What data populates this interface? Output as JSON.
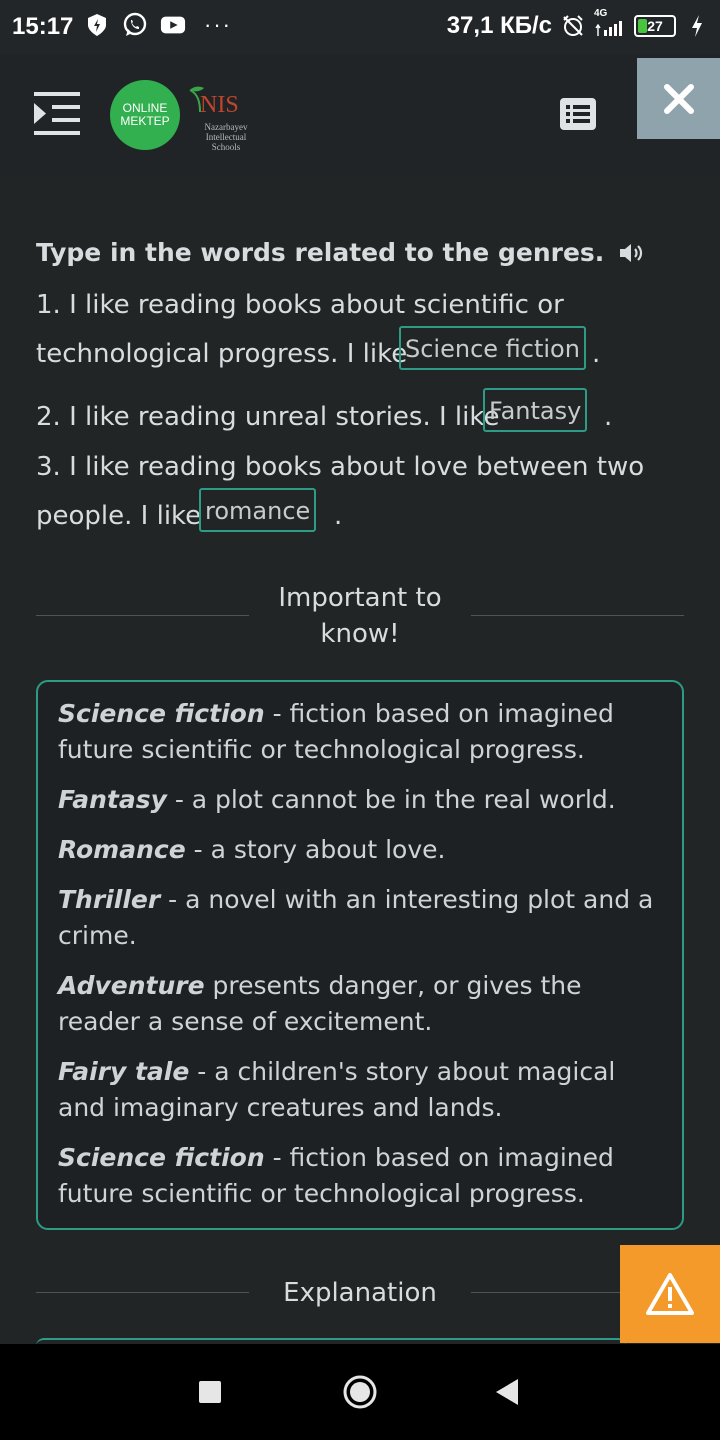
{
  "status_bar": {
    "time": "15:17",
    "network_speed": "37,1 КБ/с",
    "network_type": "4G",
    "battery": "27",
    "more_dots": "···"
  },
  "header": {
    "logo_line1": "ONLINE",
    "logo_line2": "MEKTEP",
    "nis_title": "NIS",
    "nis_subtitle": "Nazarbayev Intellectual Schools"
  },
  "task": {
    "title": "Type in the words related to the genres.",
    "q1_line1": "1. I like reading books about scientific or",
    "q1_line2": "technological progress. I like",
    "q1_answer": "Science fiction",
    "q2_text": "2. I like reading unreal stories. I like",
    "q2_answer": "Fantasy",
    "q3_line1": "3. I like reading books about love between two",
    "q3_line2": "people. I like",
    "q3_answer": "romance",
    "period": "."
  },
  "important": {
    "label": "Important to know!",
    "items": [
      {
        "term": "Science fiction",
        "text": " - fiction based on imagined future scientific or technological progress."
      },
      {
        "term": "Fantasy",
        "text": " - a plot cannot be in the real world."
      },
      {
        "term": "Romance",
        "text": " - a story about love."
      },
      {
        "term": "Thriller",
        "text": " - a novel with an interesting plot and a crime."
      },
      {
        "term": "Adventure",
        "text": " presents danger, or gives the reader a sense of excitement."
      },
      {
        "term": "Fairy tale",
        "text": " - a children's story about magical and imaginary creatures and lands."
      },
      {
        "term": "Science fiction",
        "text": " - fiction based on imagined future scientific or technological progress."
      }
    ]
  },
  "explanation": {
    "label": "Explanation"
  },
  "colors": {
    "accent_teal": "#2d9b86",
    "logo_green": "#32b050",
    "warning_orange": "#f39a2b",
    "close_bg": "#8fa3ad"
  }
}
